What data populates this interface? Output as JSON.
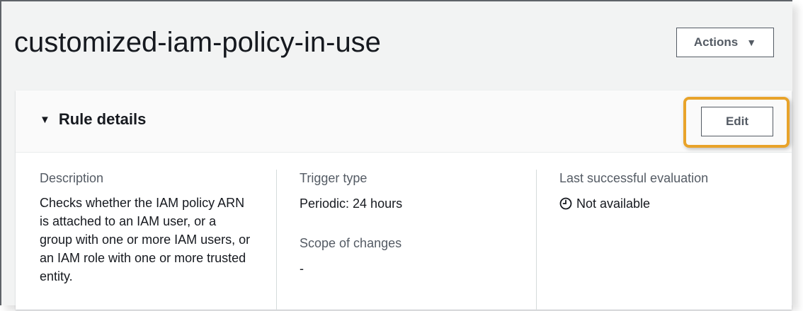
{
  "page": {
    "title": "customized-iam-policy-in-use",
    "actions_label": "Actions",
    "actions_caret": "▼"
  },
  "panel": {
    "toggle_glyph": "▼",
    "title": "Rule details",
    "edit_label": "Edit",
    "highlight_color": "#e8a32a"
  },
  "details": {
    "description_label": "Description",
    "description_value": "Checks whether the IAM policy ARN is attached to an IAM user, or a group with one or more IAM users, or an IAM role with one or more trusted entity.",
    "trigger_type_label": "Trigger type",
    "trigger_type_value": "Periodic: 24 hours",
    "scope_label": "Scope of changes",
    "scope_value": "-",
    "last_eval_label": "Last successful evaluation",
    "last_eval_value": "Not available",
    "last_eval_icon": "clock-icon"
  }
}
